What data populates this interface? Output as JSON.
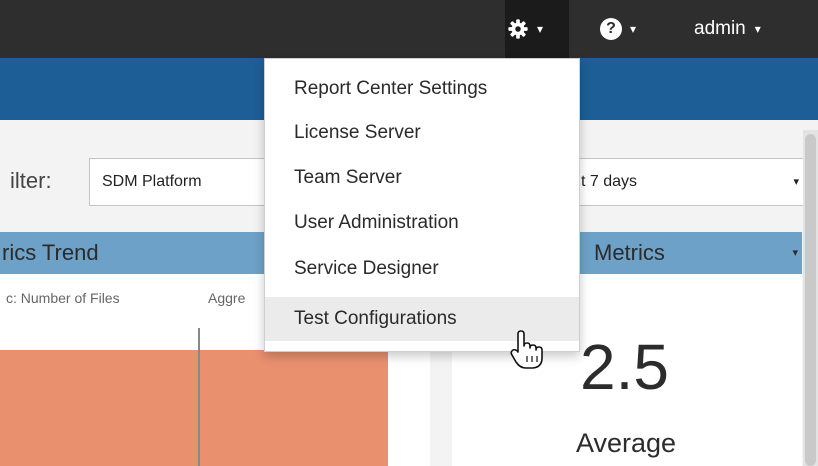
{
  "topbar": {
    "settings_icon": "gear-icon",
    "help_icon": "question-circle-icon",
    "help_glyph": "?",
    "caret_glyph": "▾",
    "user_label": "admin"
  },
  "settings_menu": {
    "items": [
      {
        "label": "Report Center Settings"
      },
      {
        "label": "License Server"
      },
      {
        "label": "Team Server"
      },
      {
        "label": "User Administration"
      },
      {
        "label": "Service Designer"
      },
      {
        "label": "Test Configurations",
        "hovered": true
      }
    ]
  },
  "filter": {
    "label": "ilter:",
    "selected": "SDM Platform"
  },
  "date_range": {
    "selected": "t 7 days"
  },
  "left_panel": {
    "title": "rics Trend",
    "metric_label": "c: Number of Files",
    "aggregation_label": "Aggre"
  },
  "right_panel": {
    "title": "Metrics",
    "value": "2.5",
    "value_label": "Average"
  },
  "colors": {
    "topbar": "#2e2e2e",
    "brand_bar": "#1d5e96",
    "panel_header": "#6ea1c8",
    "chart_bar": "#e9906e"
  }
}
